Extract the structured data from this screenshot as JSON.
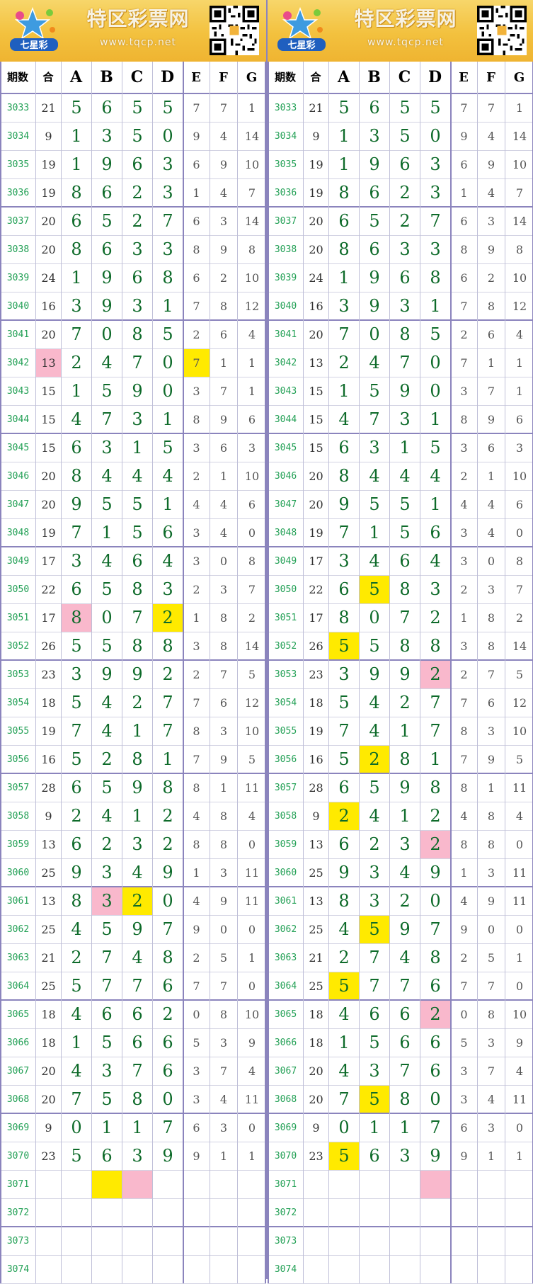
{
  "header": {
    "site_title": "特区彩票网",
    "site_url": "www.tqcp.net",
    "logo_text": "七星彩"
  },
  "columns": [
    "期数",
    "合",
    "A",
    "B",
    "C",
    "D",
    "E",
    "F",
    "G"
  ],
  "rows": [
    {
      "p": "3033",
      "s": "21",
      "a": "5",
      "b": "6",
      "c": "5",
      "d": "5",
      "e": "7",
      "f": "7",
      "g": "1"
    },
    {
      "p": "3034",
      "s": "9",
      "a": "1",
      "b": "3",
      "c": "5",
      "d": "0",
      "e": "9",
      "f": "4",
      "g": "14"
    },
    {
      "p": "3035",
      "s": "19",
      "a": "1",
      "b": "9",
      "c": "6",
      "d": "3",
      "e": "6",
      "f": "9",
      "g": "10"
    },
    {
      "p": "3036",
      "s": "19",
      "a": "8",
      "b": "6",
      "c": "2",
      "d": "3",
      "e": "1",
      "f": "4",
      "g": "7"
    },
    {
      "p": "3037",
      "s": "20",
      "a": "6",
      "b": "5",
      "c": "2",
      "d": "7",
      "e": "6",
      "f": "3",
      "g": "14"
    },
    {
      "p": "3038",
      "s": "20",
      "a": "8",
      "b": "6",
      "c": "3",
      "d": "3",
      "e": "8",
      "f": "9",
      "g": "8"
    },
    {
      "p": "3039",
      "s": "24",
      "a": "1",
      "b": "9",
      "c": "6",
      "d": "8",
      "e": "6",
      "f": "2",
      "g": "10"
    },
    {
      "p": "3040",
      "s": "16",
      "a": "3",
      "b": "9",
      "c": "3",
      "d": "1",
      "e": "7",
      "f": "8",
      "g": "12"
    },
    {
      "p": "3041",
      "s": "20",
      "a": "7",
      "b": "0",
      "c": "8",
      "d": "5",
      "e": "2",
      "f": "6",
      "g": "4"
    },
    {
      "p": "3042",
      "s": "13",
      "a": "2",
      "b": "4",
      "c": "7",
      "d": "0",
      "e": "7",
      "f": "1",
      "g": "1"
    },
    {
      "p": "3043",
      "s": "15",
      "a": "1",
      "b": "5",
      "c": "9",
      "d": "0",
      "e": "3",
      "f": "7",
      "g": "1"
    },
    {
      "p": "3044",
      "s": "15",
      "a": "4",
      "b": "7",
      "c": "3",
      "d": "1",
      "e": "8",
      "f": "9",
      "g": "6"
    },
    {
      "p": "3045",
      "s": "15",
      "a": "6",
      "b": "3",
      "c": "1",
      "d": "5",
      "e": "3",
      "f": "6",
      "g": "3"
    },
    {
      "p": "3046",
      "s": "20",
      "a": "8",
      "b": "4",
      "c": "4",
      "d": "4",
      "e": "2",
      "f": "1",
      "g": "10"
    },
    {
      "p": "3047",
      "s": "20",
      "a": "9",
      "b": "5",
      "c": "5",
      "d": "1",
      "e": "4",
      "f": "4",
      "g": "6"
    },
    {
      "p": "3048",
      "s": "19",
      "a": "7",
      "b": "1",
      "c": "5",
      "d": "6",
      "e": "3",
      "f": "4",
      "g": "0"
    },
    {
      "p": "3049",
      "s": "17",
      "a": "3",
      "b": "4",
      "c": "6",
      "d": "4",
      "e": "3",
      "f": "0",
      "g": "8"
    },
    {
      "p": "3050",
      "s": "22",
      "a": "6",
      "b": "5",
      "c": "8",
      "d": "3",
      "e": "2",
      "f": "3",
      "g": "7"
    },
    {
      "p": "3051",
      "s": "17",
      "a": "8",
      "b": "0",
      "c": "7",
      "d": "2",
      "e": "1",
      "f": "8",
      "g": "2"
    },
    {
      "p": "3052",
      "s": "26",
      "a": "5",
      "b": "5",
      "c": "8",
      "d": "8",
      "e": "3",
      "f": "8",
      "g": "14"
    },
    {
      "p": "3053",
      "s": "23",
      "a": "3",
      "b": "9",
      "c": "9",
      "d": "2",
      "e": "2",
      "f": "7",
      "g": "5"
    },
    {
      "p": "3054",
      "s": "18",
      "a": "5",
      "b": "4",
      "c": "2",
      "d": "7",
      "e": "7",
      "f": "6",
      "g": "12"
    },
    {
      "p": "3055",
      "s": "19",
      "a": "7",
      "b": "4",
      "c": "1",
      "d": "7",
      "e": "8",
      "f": "3",
      "g": "10"
    },
    {
      "p": "3056",
      "s": "16",
      "a": "5",
      "b": "2",
      "c": "8",
      "d": "1",
      "e": "7",
      "f": "9",
      "g": "5"
    },
    {
      "p": "3057",
      "s": "28",
      "a": "6",
      "b": "5",
      "c": "9",
      "d": "8",
      "e": "8",
      "f": "1",
      "g": "11"
    },
    {
      "p": "3058",
      "s": "9",
      "a": "2",
      "b": "4",
      "c": "1",
      "d": "2",
      "e": "4",
      "f": "8",
      "g": "4"
    },
    {
      "p": "3059",
      "s": "13",
      "a": "6",
      "b": "2",
      "c": "3",
      "d": "2",
      "e": "8",
      "f": "8",
      "g": "0"
    },
    {
      "p": "3060",
      "s": "25",
      "a": "9",
      "b": "3",
      "c": "4",
      "d": "9",
      "e": "1",
      "f": "3",
      "g": "11"
    },
    {
      "p": "3061",
      "s": "13",
      "a": "8",
      "b": "3",
      "c": "2",
      "d": "0",
      "e": "4",
      "f": "9",
      "g": "11"
    },
    {
      "p": "3062",
      "s": "25",
      "a": "4",
      "b": "5",
      "c": "9",
      "d": "7",
      "e": "9",
      "f": "0",
      "g": "0"
    },
    {
      "p": "3063",
      "s": "21",
      "a": "2",
      "b": "7",
      "c": "4",
      "d": "8",
      "e": "2",
      "f": "5",
      "g": "1"
    },
    {
      "p": "3064",
      "s": "25",
      "a": "5",
      "b": "7",
      "c": "7",
      "d": "6",
      "e": "7",
      "f": "7",
      "g": "0"
    },
    {
      "p": "3065",
      "s": "18",
      "a": "4",
      "b": "6",
      "c": "6",
      "d": "2",
      "e": "0",
      "f": "8",
      "g": "10"
    },
    {
      "p": "3066",
      "s": "18",
      "a": "1",
      "b": "5",
      "c": "6",
      "d": "6",
      "e": "5",
      "f": "3",
      "g": "9"
    },
    {
      "p": "3067",
      "s": "20",
      "a": "4",
      "b": "3",
      "c": "7",
      "d": "6",
      "e": "3",
      "f": "7",
      "g": "4"
    },
    {
      "p": "3068",
      "s": "20",
      "a": "7",
      "b": "5",
      "c": "8",
      "d": "0",
      "e": "3",
      "f": "4",
      "g": "11"
    },
    {
      "p": "3069",
      "s": "9",
      "a": "0",
      "b": "1",
      "c": "1",
      "d": "7",
      "e": "6",
      "f": "3",
      "g": "0"
    },
    {
      "p": "3070",
      "s": "23",
      "a": "5",
      "b": "6",
      "c": "3",
      "d": "9",
      "e": "9",
      "f": "1",
      "g": "1"
    },
    {
      "p": "3071",
      "s": "",
      "a": "",
      "b": "",
      "c": "",
      "d": "",
      "e": "",
      "f": "",
      "g": ""
    },
    {
      "p": "3072",
      "s": "",
      "a": "",
      "b": "",
      "c": "",
      "d": "",
      "e": "",
      "f": "",
      "g": ""
    },
    {
      "p": "3073",
      "s": "",
      "a": "",
      "b": "",
      "c": "",
      "d": "",
      "e": "",
      "f": "",
      "g": ""
    },
    {
      "p": "3074",
      "s": "",
      "a": "",
      "b": "",
      "c": "",
      "d": "",
      "e": "",
      "f": "",
      "g": ""
    }
  ],
  "highlight_colors": {
    "yellow": "#ffea00",
    "pink": "#f9b8cc"
  },
  "highlights_left": [
    {
      "row": "3042",
      "col": "s",
      "color": "pink"
    },
    {
      "row": "3042",
      "col": "e",
      "color": "yellow"
    },
    {
      "row": "3051",
      "col": "a",
      "color": "pink"
    },
    {
      "row": "3051",
      "col": "d",
      "color": "yellow"
    },
    {
      "row": "3061",
      "col": "b",
      "color": "pink"
    },
    {
      "row": "3061",
      "col": "c",
      "color": "yellow"
    },
    {
      "row": "3071",
      "col": "b",
      "color": "yellow"
    },
    {
      "row": "3071",
      "col": "c",
      "color": "pink"
    }
  ],
  "highlights_right": [
    {
      "row": "3050",
      "col": "b",
      "color": "yellow"
    },
    {
      "row": "3052",
      "col": "a",
      "color": "yellow"
    },
    {
      "row": "3053",
      "col": "d",
      "color": "pink"
    },
    {
      "row": "3056",
      "col": "b",
      "color": "yellow"
    },
    {
      "row": "3058",
      "col": "a",
      "color": "yellow"
    },
    {
      "row": "3059",
      "col": "d",
      "color": "pink"
    },
    {
      "row": "3062",
      "col": "b",
      "color": "yellow"
    },
    {
      "row": "3064",
      "col": "a",
      "color": "yellow"
    },
    {
      "row": "3065",
      "col": "d",
      "color": "pink"
    },
    {
      "row": "3068",
      "col": "b",
      "color": "yellow"
    },
    {
      "row": "3070",
      "col": "a",
      "color": "yellow"
    },
    {
      "row": "3071",
      "col": "d",
      "color": "pink"
    }
  ]
}
